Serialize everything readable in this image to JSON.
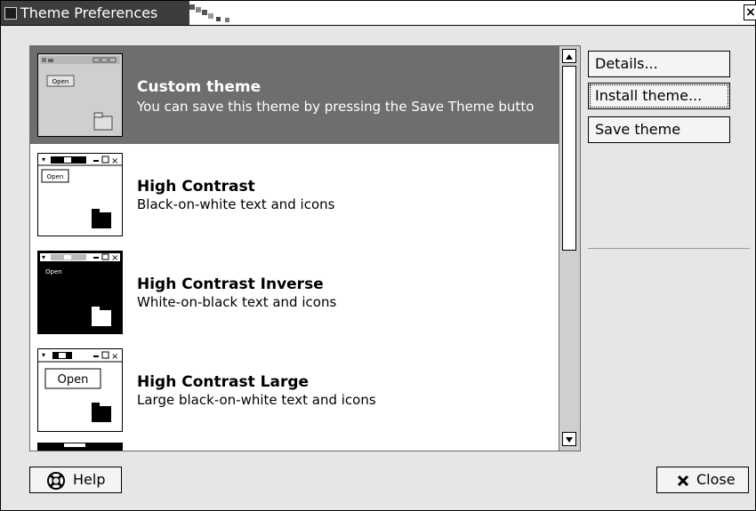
{
  "window": {
    "title": "Theme Preferences",
    "close_glyph": "×"
  },
  "themes": [
    {
      "name": "Custom theme",
      "description": "You can save this theme by pressing the Save Theme butto",
      "selected": true,
      "preview_style": "custom",
      "preview_open_label": "Open"
    },
    {
      "name": "High Contrast",
      "description": "Black-on-white text and icons",
      "selected": false,
      "preview_style": "high-contrast",
      "preview_open_label": "Open"
    },
    {
      "name": "High Contrast Inverse",
      "description": "White-on-black text and icons",
      "selected": false,
      "preview_style": "high-contrast-inverse",
      "preview_open_label": "Open"
    },
    {
      "name": "High Contrast Large",
      "description": "Large black-on-white text and icons",
      "selected": false,
      "preview_style": "high-contrast-large",
      "preview_open_label": "Open"
    }
  ],
  "actions": {
    "details_label": "Details...",
    "install_label": "Install theme...",
    "save_label": "Save theme"
  },
  "footer": {
    "help_label": "Help",
    "close_label": "Close"
  },
  "icons": {
    "help": "lifebuoy-icon",
    "close": "x-icon",
    "scroll_up": "up-arrow-icon",
    "scroll_down": "down-arrow-icon"
  }
}
